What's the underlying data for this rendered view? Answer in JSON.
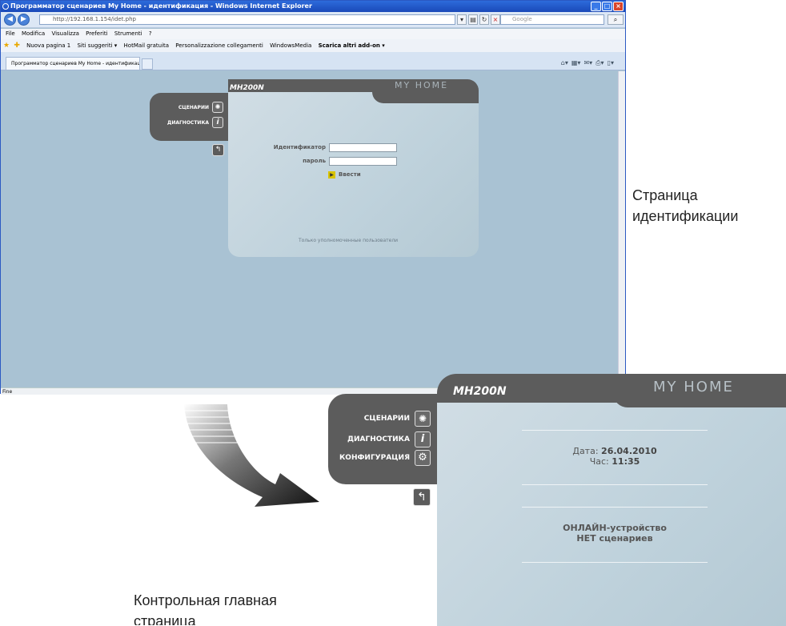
{
  "browser": {
    "title": "Программатор сценариев My Home - идентификация - Windows Internet Explorer",
    "address": "http://192.168.1.154/idet.php",
    "search_placeholder": "Google",
    "menu": [
      "File",
      "Modifica",
      "Visualizza",
      "Preferiti",
      "Strumenti",
      "?"
    ],
    "favorites": [
      "Nuova pagina 1",
      "Siti suggeriti ▾",
      "HotMail gratuita",
      "Personalizzazione collegamenti",
      "WindowsMedia",
      "Scarica altri add-on ▾"
    ],
    "tab_label": "Программатор сценариев My Home - идентификация",
    "status": "Fine"
  },
  "login_panel": {
    "model": "MH200N",
    "brand": "MY HOME",
    "menu": [
      {
        "label": "СЦЕНАРИИ",
        "icon": "scenario-icon"
      },
      {
        "label": "ДИАГНОСТИКА",
        "icon": "info-icon"
      }
    ],
    "back_icon": "back-arrow-icon",
    "id_label": "Идентификатор",
    "password_label": "пароль",
    "enter_label": "Ввести",
    "note": "Только уполномоченные пользователи"
  },
  "home_panel": {
    "model": "MH200N",
    "brand": "MY HOME",
    "menu": [
      {
        "label": "СЦЕНАРИИ",
        "icon": "scenario-icon"
      },
      {
        "label": "ДИАГНОСТИКА",
        "icon": "info-icon"
      },
      {
        "label": "КОНФИГУРАЦИЯ",
        "icon": "config-gear-icon"
      }
    ],
    "back_icon": "back-arrow-icon",
    "date_label": "Дата:",
    "date_value": "26.04.2010",
    "time_label": "Час:",
    "time_value": "11:35",
    "status_line1": "ОНЛАЙН-устройство",
    "status_line2": "НЕТ сценариев"
  },
  "captions": {
    "login_page": [
      "Страница",
      "идентификации"
    ],
    "home_page": [
      "Контрольная главная",
      "страница"
    ]
  },
  "colors": {
    "panel_dark": "#5c5c5c",
    "page_bg": "#a9c2d3",
    "enter_accent": "#d8c300"
  }
}
